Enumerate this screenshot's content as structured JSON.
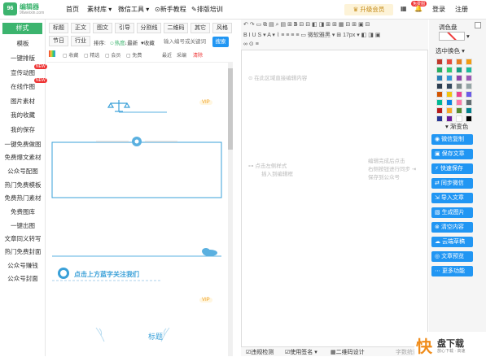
{
  "logo": {
    "mark": "96",
    "name": "编辑器",
    "url": "96weixin.com"
  },
  "nav": [
    "首页",
    "素材库 ▾",
    "微信工具 ▾",
    "新手教程",
    "排版培训"
  ],
  "upgrade": "升级会员",
  "hot_badge": "免费图",
  "login": "登录",
  "register": "注册",
  "sidebar": {
    "style_tab": "样式",
    "items": [
      "模板",
      "一键排版",
      "宣传动图",
      "在线作图",
      "图片素材",
      "我的收藏",
      "我的保存",
      "一键免费做图",
      "免费爆文素材",
      "公众号配图",
      "热门免费模板",
      "免费热门素材",
      "免费图库",
      "一键出图",
      "文章同义转写",
      "热门免费封面",
      "公众号赚钱",
      "公众号封面"
    ],
    "badges": [
      "NEW",
      "NEW"
    ]
  },
  "tabs_row1": [
    "标题",
    "正文",
    "图文",
    "引导",
    "分割线",
    "二维码",
    "其它",
    "风格"
  ],
  "tabs_row2": [
    "节日",
    "行业"
  ],
  "filter": {
    "sort_label": "排序:",
    "opt1": "☺热度",
    "opt2": "↓最新",
    "opt3": "♥收藏"
  },
  "search": {
    "placeholder": "输入编号或关键词",
    "button": "搜索"
  },
  "subfilters": [
    "收藏",
    "精选",
    "会员",
    "免费",
    "最近",
    "采编",
    "清除"
  ],
  "preview": {
    "vip": "VIP",
    "follow_text": "点击上方蓝字关注我们",
    "title_text": "标题"
  },
  "editor": {
    "ph1": "在此区域直接编辑内容",
    "ph2": "点击左侧样式",
    "ph3": "插入到编辑框",
    "ph4": "编辑完成后点击",
    "ph5": "右侧按钮进行同步",
    "ph6": "保存到公众号",
    "font": "微软雅黑",
    "size": "17px"
  },
  "bottombar": {
    "check": "违规检测",
    "copy": "使用签名 ▾",
    "qr": "二维码设计",
    "count": "字数统计"
  },
  "right": {
    "title": "调色盘",
    "sel": "选中换色",
    "gradient": "渐变色",
    "buttons": [
      "微信复制",
      "保存文章",
      "快速保存",
      "同步微信",
      "导入文章",
      "生成图片",
      "清空内容",
      "云端草稿",
      "文章预览",
      "更多功能"
    ]
  },
  "watermark": {
    "char": "快",
    "name": "盘下载",
    "sub": "放心下载 · 高速"
  },
  "colors": [
    "#c0392b",
    "#e74c3c",
    "#e67e22",
    "#f39c12",
    "#27ae60",
    "#2ecc71",
    "#16a085",
    "#1abc9c",
    "#2980b9",
    "#3498db",
    "#8e44ad",
    "#9b59b6",
    "#2c3e50",
    "#34495e",
    "#7f8c8d",
    "#95a5a6",
    "#d35400",
    "#f1c40f",
    "#e84393",
    "#6c5ce7",
    "#00b894",
    "#0984e3",
    "#fd79a8",
    "#636e72",
    "#b71c1c",
    "#f9a825",
    "#558b2f",
    "#00838f",
    "#283593",
    "#6a1b9a",
    "#ffffff",
    "#000000"
  ]
}
